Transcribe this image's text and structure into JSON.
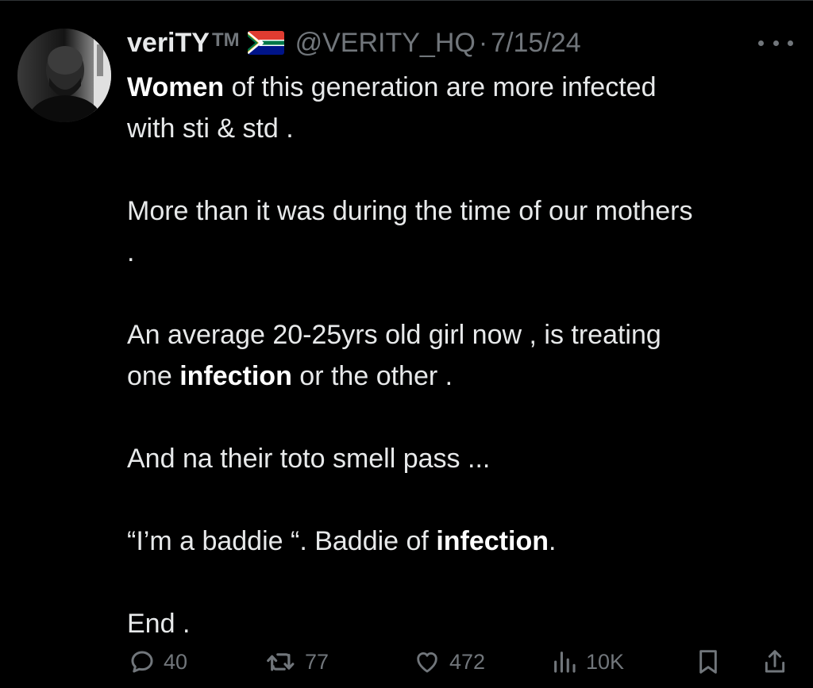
{
  "author": {
    "display_name": "veriTY",
    "badge": "TM",
    "flag": "south-africa-flag",
    "handle": "@VERITY_HQ",
    "separator": "·",
    "date": "7/15/24"
  },
  "tweet": {
    "lines": [
      [
        {
          "text": "Women",
          "bold": true
        },
        {
          "text": " of this generation are more infected"
        }
      ],
      [
        {
          "text": "with sti & std ."
        }
      ],
      [],
      [
        {
          "text": "More than it was during the time of our mothers"
        }
      ],
      [
        {
          "text": "."
        }
      ],
      [],
      [
        {
          "text": "An average 20-25yrs old girl now , is treating"
        }
      ],
      [
        {
          "text": "one "
        },
        {
          "text": "infection",
          "bold": true
        },
        {
          "text": " or the other ."
        }
      ],
      [],
      [
        {
          "text": "And na their toto smell pass ..."
        }
      ],
      [],
      [
        {
          "text": "“I’m a baddie “.   Baddie of "
        },
        {
          "text": "infection",
          "bold": true
        },
        {
          "text": "."
        }
      ],
      [],
      [
        {
          "text": "End ."
        }
      ]
    ]
  },
  "actions": {
    "replies": "40",
    "reposts": "77",
    "likes": "472",
    "views": "10K"
  },
  "colors": {
    "background": "#000000",
    "text": "#e7e9ea",
    "secondary": "#71767b"
  }
}
